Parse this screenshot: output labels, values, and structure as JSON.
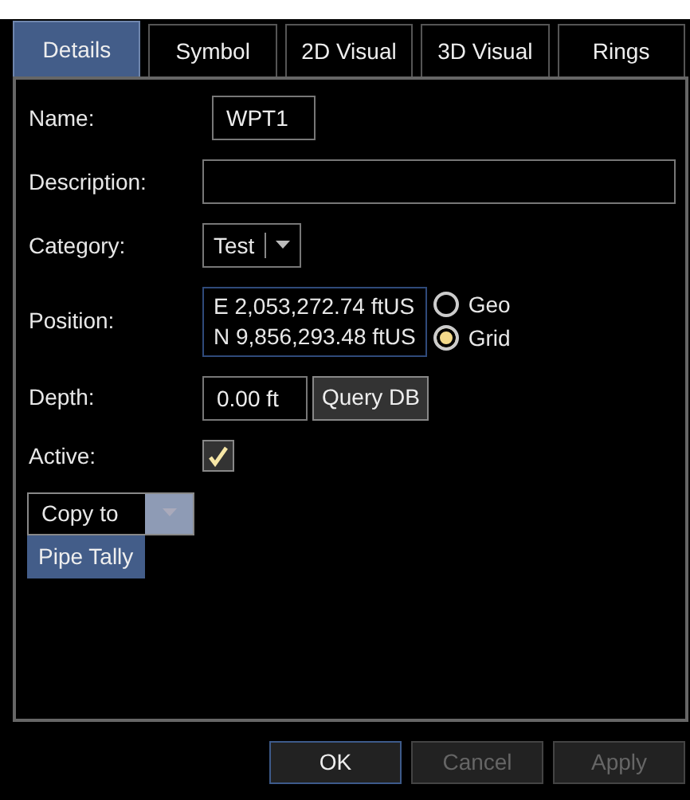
{
  "tabs": [
    {
      "label": "Details",
      "selected": true
    },
    {
      "label": "Symbol",
      "selected": false
    },
    {
      "label": "2D Visual",
      "selected": false
    },
    {
      "label": "3D Visual",
      "selected": false
    },
    {
      "label": "Rings",
      "selected": false
    }
  ],
  "fields": [
    {
      "kind": "short_text",
      "label": "Name:",
      "value": "WPT1"
    },
    {
      "kind": "long_text",
      "label": "Description:"
    },
    {
      "kind": "combo",
      "label": "Category:",
      "value": "Test"
    },
    {
      "kind": "position",
      "label": "Position:",
      "lines": [
        "E 2,053,272.74 ftUS",
        "N 9,856,293.48 ftUS"
      ],
      "options": [
        {
          "label": "Geo",
          "selected": false
        },
        {
          "label": "Grid",
          "selected": true
        }
      ]
    },
    {
      "kind": "depth",
      "label": "Depth:",
      "value": "0.00 ft",
      "button": "Query DB"
    },
    {
      "kind": "checkbox",
      "label": "Active:",
      "checked": true
    }
  ],
  "copy_to": {
    "label": "Copy to",
    "expanded": true,
    "menu": [
      {
        "label": "Pipe Tally",
        "selected": true
      }
    ]
  },
  "buttons": [
    {
      "label": "OK",
      "disabled": false,
      "focused": true
    },
    {
      "label": "Cancel",
      "disabled": true,
      "focused": false
    },
    {
      "label": "Apply",
      "disabled": true,
      "focused": false
    }
  ]
}
